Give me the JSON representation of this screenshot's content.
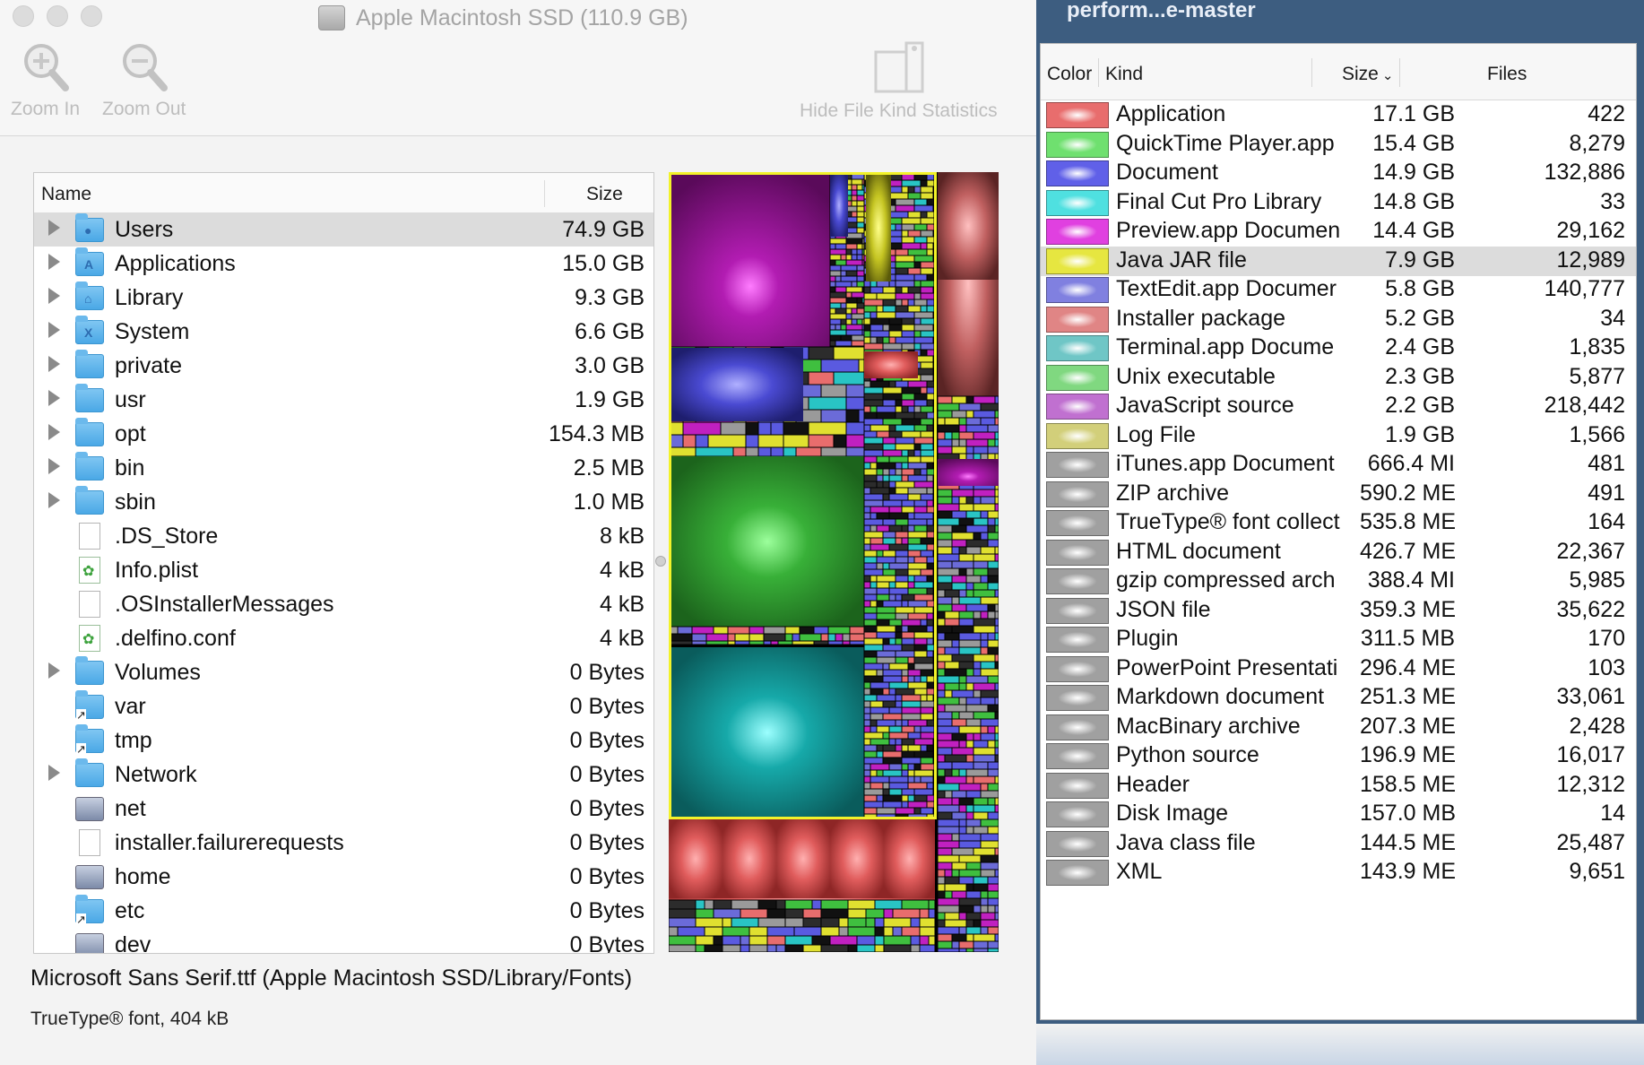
{
  "window": {
    "title": "Apple Macintosh SSD (110.9 GB)"
  },
  "toolbar": {
    "zoom_in_label": "Zoom In",
    "zoom_out_label": "Zoom Out",
    "hide_stats_label": "Hide File Kind Statistics"
  },
  "file_list": {
    "headers": {
      "name": "Name",
      "size": "Size"
    },
    "rows": [
      {
        "name": "Users",
        "size": "74.9 GB",
        "icon": "users-folder-icon",
        "expandable": true,
        "selected": true
      },
      {
        "name": "Applications",
        "size": "15.0 GB",
        "icon": "applications-folder-icon",
        "expandable": true
      },
      {
        "name": "Library",
        "size": "9.3 GB",
        "icon": "library-folder-icon",
        "expandable": true
      },
      {
        "name": "System",
        "size": "6.6 GB",
        "icon": "system-folder-icon",
        "expandable": true
      },
      {
        "name": "private",
        "size": "3.0 GB",
        "icon": "folder-icon",
        "expandable": true
      },
      {
        "name": "usr",
        "size": "1.9 GB",
        "icon": "folder-icon",
        "expandable": true
      },
      {
        "name": "opt",
        "size": "154.3 MB",
        "icon": "folder-icon",
        "expandable": true
      },
      {
        "name": "bin",
        "size": "2.5 MB",
        "icon": "folder-icon",
        "expandable": true
      },
      {
        "name": "sbin",
        "size": "1.0 MB",
        "icon": "folder-icon",
        "expandable": true
      },
      {
        "name": ".DS_Store",
        "size": "8 kB",
        "icon": "document-icon",
        "expandable": false
      },
      {
        "name": "Info.plist",
        "size": "4 kB",
        "icon": "plist-icon",
        "expandable": false
      },
      {
        "name": ".OSInstallerMessages",
        "size": "4 kB",
        "icon": "document-icon",
        "expandable": false
      },
      {
        "name": ".delfino.conf",
        "size": "4 kB",
        "icon": "plist-icon",
        "expandable": false
      },
      {
        "name": "Volumes",
        "size": "0 Bytes",
        "icon": "folder-icon",
        "expandable": true
      },
      {
        "name": "var",
        "size": "0 Bytes",
        "icon": "alias-folder-icon",
        "expandable": false
      },
      {
        "name": "tmp",
        "size": "0 Bytes",
        "icon": "alias-folder-icon",
        "expandable": false
      },
      {
        "name": "Network",
        "size": "0 Bytes",
        "icon": "folder-icon",
        "expandable": true
      },
      {
        "name": "net",
        "size": "0 Bytes",
        "icon": "drive-icon",
        "expandable": false
      },
      {
        "name": "installer.failurerequests",
        "size": "0 Bytes",
        "icon": "document-icon",
        "expandable": false
      },
      {
        "name": "home",
        "size": "0 Bytes",
        "icon": "drive-icon",
        "expandable": false
      },
      {
        "name": "etc",
        "size": "0 Bytes",
        "icon": "alias-folder-icon",
        "expandable": false
      },
      {
        "name": "dev",
        "size": "0 Bytes",
        "icon": "drive-icon",
        "expandable": false
      }
    ]
  },
  "status": {
    "selected_file": "Microsoft Sans Serif.ttf (Apple Macintosh SSD/Library/Fonts)",
    "selected_info": "TrueType® font, 404 kB"
  },
  "right_window": {
    "title": "perform...e-master"
  },
  "kind_stats": {
    "headers": {
      "color": "Color",
      "kind": "Kind",
      "size": "Size",
      "files": "Files"
    },
    "sort_indicator": "chevron-down-icon",
    "rows": [
      {
        "kind": "Application",
        "size": "17.1 GB",
        "files": "422",
        "color": "#e86d6d"
      },
      {
        "kind": "QuickTime Player.app",
        "size": "15.4 GB",
        "files": "8,279",
        "color": "#6fe06f"
      },
      {
        "kind": "Document",
        "size": "14.9 GB",
        "files": "132,886",
        "color": "#6060e8"
      },
      {
        "kind": "Final Cut Pro Library",
        "size": "14.8 GB",
        "files": "33",
        "color": "#4fe0e0"
      },
      {
        "kind": "Preview.app Documen",
        "size": "14.4 GB",
        "files": "29,162",
        "color": "#e040e0"
      },
      {
        "kind": "Java JAR file",
        "size": "7.9 GB",
        "files": "12,989",
        "color": "#e6e640",
        "selected": true
      },
      {
        "kind": "TextEdit.app Documer",
        "size": "5.8 GB",
        "files": "140,777",
        "color": "#8080e0"
      },
      {
        "kind": "Installer package",
        "size": "5.2 GB",
        "files": "34",
        "color": "#e08585"
      },
      {
        "kind": "Terminal.app Docume",
        "size": "2.4 GB",
        "files": "1,835",
        "color": "#6fc6c6"
      },
      {
        "kind": "Unix executable",
        "size": "2.3 GB",
        "files": "5,877",
        "color": "#80d880"
      },
      {
        "kind": "JavaScript source",
        "size": "2.2 GB",
        "files": "218,442",
        "color": "#c070d0"
      },
      {
        "kind": "Log File",
        "size": "1.9 GB",
        "files": "1,566",
        "color": "#d2cf7a"
      },
      {
        "kind": "iTunes.app Document",
        "size": "666.4 MI",
        "files": "481",
        "color": "#a0a0a0"
      },
      {
        "kind": "ZIP archive",
        "size": "590.2 ME",
        "files": "491",
        "color": "#a0a0a0"
      },
      {
        "kind": "TrueType® font collect",
        "size": "535.8 ME",
        "files": "164",
        "color": "#a0a0a0"
      },
      {
        "kind": "HTML document",
        "size": "426.7 ME",
        "files": "22,367",
        "color": "#a0a0a0"
      },
      {
        "kind": "gzip compressed arch",
        "size": "388.4 MI",
        "files": "5,985",
        "color": "#a0a0a0"
      },
      {
        "kind": "JSON file",
        "size": "359.3 ME",
        "files": "35,622",
        "color": "#a0a0a0"
      },
      {
        "kind": "Plugin",
        "size": "311.5 MB",
        "files": "170",
        "color": "#a0a0a0"
      },
      {
        "kind": "PowerPoint Presentati",
        "size": "296.4 ME",
        "files": "103",
        "color": "#a0a0a0"
      },
      {
        "kind": "Markdown document",
        "size": "251.3 ME",
        "files": "33,061",
        "color": "#a0a0a0"
      },
      {
        "kind": "MacBinary archive",
        "size": "207.3 ME",
        "files": "2,428",
        "color": "#a0a0a0"
      },
      {
        "kind": "Python source",
        "size": "196.9 ME",
        "files": "16,017",
        "color": "#a0a0a0"
      },
      {
        "kind": "Header",
        "size": "158.5 ME",
        "files": "12,312",
        "color": "#a0a0a0"
      },
      {
        "kind": "Disk Image",
        "size": "157.0 MB",
        "files": "14",
        "color": "#a0a0a0"
      },
      {
        "kind": "Java class file",
        "size": "144.5 ME",
        "files": "25,487",
        "color": "#a0a0a0"
      },
      {
        "kind": "XML",
        "size": "143.9 ME",
        "files": "9,651",
        "color": "#a0a0a0"
      }
    ]
  },
  "treemap": {
    "colors": {
      "application": "#e86d6d",
      "quicktime": "#3fbf3f",
      "document": "#5a5ae0",
      "final_cut": "#29c4c4",
      "preview": "#c020c0",
      "jar": "#e0e030",
      "highlight_border": "#f2f22a"
    }
  }
}
